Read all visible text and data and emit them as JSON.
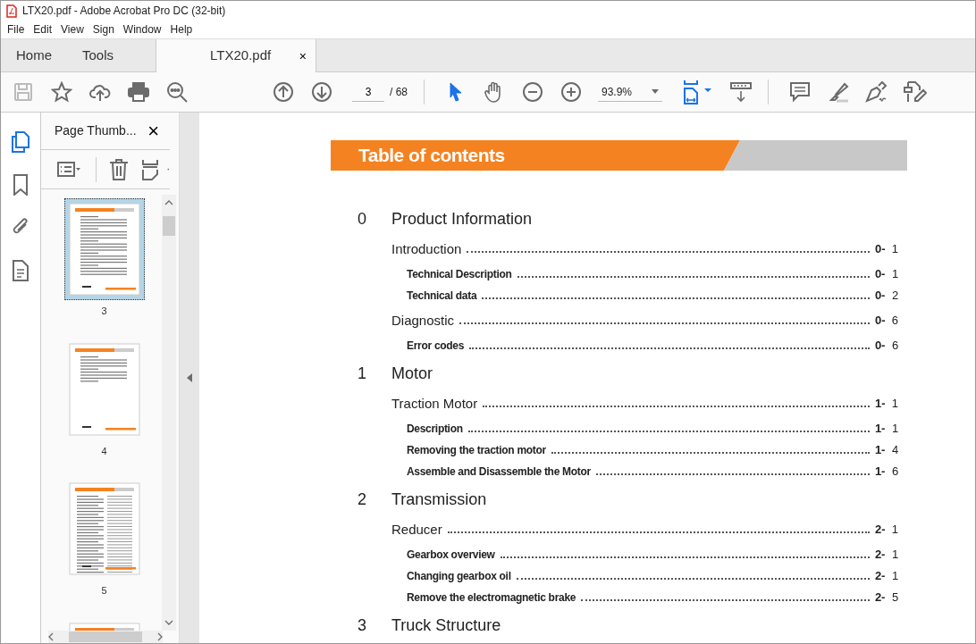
{
  "window": {
    "title": "LTX20.pdf - Adobe Acrobat Pro DC (32-bit)"
  },
  "menu": [
    "File",
    "Edit",
    "View",
    "Sign",
    "Window",
    "Help"
  ],
  "tabs": [
    {
      "label": "Home",
      "selected": false
    },
    {
      "label": "Tools",
      "selected": false
    },
    {
      "label": "LTX20.pdf",
      "selected": true,
      "close": "×"
    }
  ],
  "toolbar": {
    "page_field": {
      "value": "3"
    },
    "page_count": "/ 68",
    "zoom_field": {
      "value": "93.9%"
    }
  },
  "thumbnail_panel": {
    "title": "Page Thumb...",
    "close": "×",
    "thumbnails": [
      {
        "label": "3",
        "selected": true
      },
      {
        "label": "4",
        "selected": false
      },
      {
        "label": "5",
        "selected": false
      },
      {
        "selected": false
      }
    ]
  },
  "document": {
    "heading": "Table of contents",
    "sections": [
      {
        "number": "0",
        "title": "Product Information",
        "entries": [
          {
            "title": "Introduction",
            "chapter": "0-",
            "page": "1",
            "children": [
              {
                "title": "Technical Description",
                "chapter": "0-",
                "page": "1"
              },
              {
                "title": "Technical data",
                "chapter": "0-",
                "page": "2"
              }
            ]
          },
          {
            "title": "Diagnostic",
            "chapter": "0-",
            "page": "6",
            "children": [
              {
                "title": "Error codes",
                "chapter": "0-",
                "page": "6"
              }
            ]
          }
        ]
      },
      {
        "number": "1",
        "title": "Motor",
        "entries": [
          {
            "title": "Traction Motor",
            "chapter": "1-",
            "page": "1",
            "children": [
              {
                "title": "Description",
                "chapter": "1-",
                "page": "1"
              },
              {
                "title": "Removing the traction motor",
                "chapter": "1-",
                "page": "4"
              },
              {
                "title": "Assemble and Disassemble the Motor",
                "chapter": "1-",
                "page": "6"
              }
            ]
          }
        ]
      },
      {
        "number": "2",
        "title": "Transmission",
        "entries": [
          {
            "title": "Reducer",
            "chapter": "2-",
            "page": "1",
            "children": [
              {
                "title": "Gearbox overview",
                "chapter": "2-",
                "page": "1"
              },
              {
                "title": "Changing gearbox oil",
                "chapter": "2-",
                "page": "1"
              },
              {
                "title": "Remove the electromagnetic brake",
                "chapter": "2-",
                "page": "5"
              }
            ]
          }
        ]
      },
      {
        "number": "3",
        "title": "Truck Structure"
      }
    ]
  }
}
